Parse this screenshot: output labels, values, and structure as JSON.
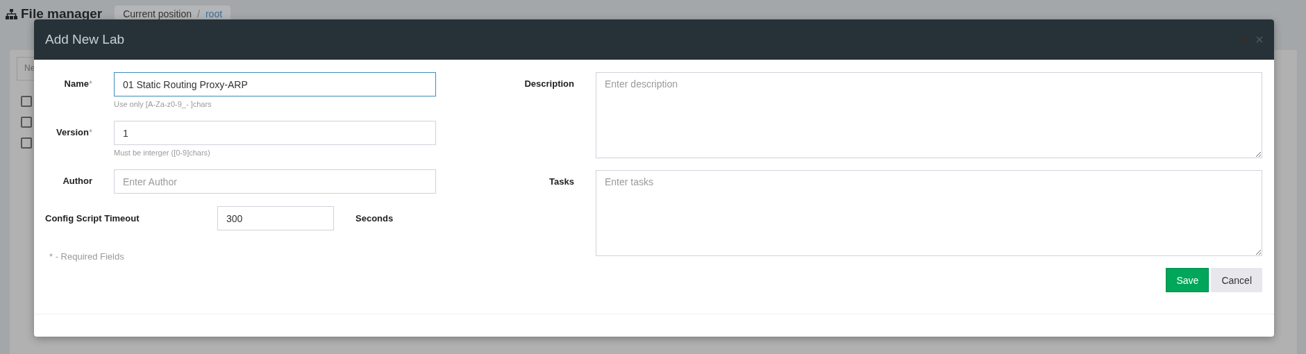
{
  "background": {
    "title": "File manager",
    "breadcrumb": {
      "label": "Current position",
      "separator": "/",
      "link": "root"
    },
    "toolbar_button": "Ne",
    "checkboxes": [
      {
        "checked": false
      },
      {
        "checked": false
      },
      {
        "checked": false
      }
    ]
  },
  "dialog": {
    "title": "Add New Lab",
    "fields": [
      {
        "label": "Name",
        "mark": "*",
        "value": "01 Static Routing Proxy-ARP",
        "focused": true,
        "hint": "Use only [A-Za-z0-9_- ]chars"
      },
      {
        "label": "Version",
        "mark": "*",
        "value": "1",
        "focused": false,
        "hint": "Must be interger ([0-9]chars)"
      },
      {
        "label": "Author",
        "placeholder": "Enter Author",
        "focused": false
      }
    ],
    "timeout": {
      "label": "Config Script Timeout",
      "value": "300",
      "unit": "Seconds"
    },
    "required_note": "* - Required Fields",
    "areas": [
      {
        "label": "Description",
        "placeholder": "Enter description"
      },
      {
        "label": "Tasks",
        "placeholder": "Enter tasks"
      }
    ],
    "buttons": [
      {
        "label": "Save",
        "kind": "primary"
      },
      {
        "label": "Cancel",
        "kind": "secondary"
      }
    ]
  }
}
